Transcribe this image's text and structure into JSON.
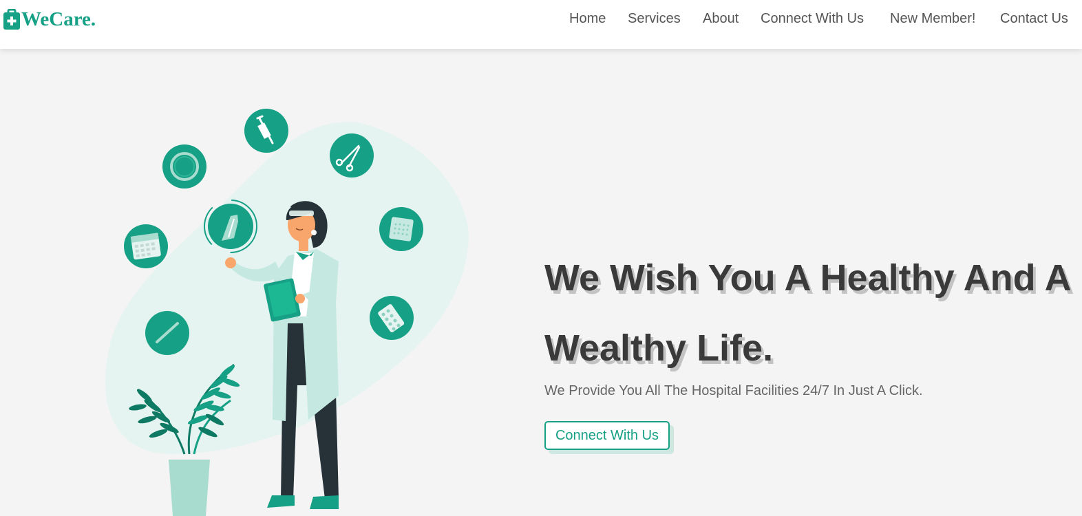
{
  "brand": {
    "name": "WeCare.",
    "icon": "medical-kit-icon",
    "color": "#16a085"
  },
  "nav": {
    "items": [
      {
        "label": "Home"
      },
      {
        "label": "Services"
      },
      {
        "label": "About"
      },
      {
        "label": "Connect With Us"
      },
      {
        "label": "New Member!"
      },
      {
        "label": "Contact Us"
      }
    ]
  },
  "hero": {
    "headline": "We Wish You A Healthy And A Wealthy Life.",
    "subtext": "We Provide You All The Hospital Facilities 24/7 In Just A Click.",
    "cta_label": "Connect With Us"
  },
  "illustration": {
    "icons": [
      "syringe-icon",
      "ring-icon",
      "scissors-icon",
      "glove-icon",
      "gauze-icon",
      "calendar-icon",
      "pill-pack-icon",
      "thermometer-icon"
    ],
    "subject": "doctor-with-clipboard",
    "plant": "potted-plant"
  },
  "colors": {
    "accent": "#16a085",
    "headline": "#3a3a3a",
    "background": "#f4f4f4",
    "blob": "#e6f4f1"
  }
}
